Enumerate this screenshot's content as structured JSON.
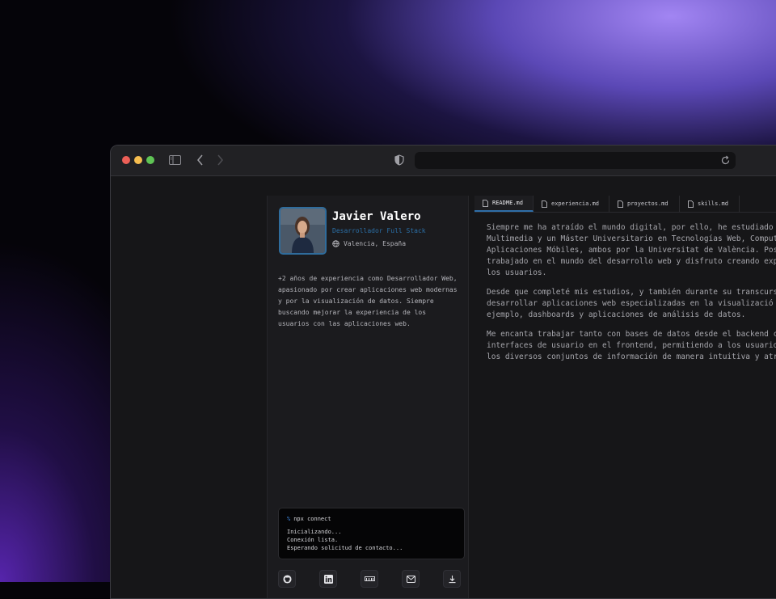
{
  "profile": {
    "name": "Javier Valero",
    "role": "Desarrollador Full Stack",
    "location": "Valencia, España",
    "bio": "+2 años de experiencia como Desarrollador Web, apasionado por crear aplicaciones web modernas y por la visualización de datos. Siempre buscando mejorar la experiencia de los usuarios con las aplicaciones web."
  },
  "tabs": [
    {
      "label": "README.md",
      "active": true
    },
    {
      "label": "experiencia.md",
      "active": false
    },
    {
      "label": "proyectos.md",
      "active": false
    },
    {
      "label": "skills.md",
      "active": false
    }
  ],
  "readme": {
    "p1": [
      "Siempre me ha atraído el mundo digital, por ello, he estudiado",
      "Multimedia y un Máster Universitario en Tecnologías Web, Comput",
      "Aplicaciones Móbiles, ambos por la Universitat de València. Pos",
      "trabajado en el mundo del desarrollo web y disfruto creando exp",
      "los usuarios."
    ],
    "p2": [
      "Desde que completé mis estudios, y también durante su transcurs",
      "desarrollar aplicaciones web especializadas en la visualizació",
      "ejemplo, dashboards y aplicaciones de análisis de datos."
    ],
    "p3": [
      "Me encanta trabajar tanto con bases de datos desde el backend c",
      "interfaces de usuario en el frontend, permitiendo a los usuario",
      "los diversos conjuntos de información de manera intuitiva y atr"
    ]
  },
  "terminal": {
    "prompt": "%",
    "command": "npx connect",
    "lines": [
      "Inicializando...",
      "Conexión lista.",
      "Esperando solicitud de contacto..."
    ]
  },
  "social": [
    "github-icon",
    "linkedin-icon",
    "npm-icon",
    "mail-icon",
    "download-icon"
  ],
  "colors": {
    "accent": "#2f6ea8",
    "role_text": "#2b6fa6",
    "window_bg": "#161618",
    "glow": "#8f75ff"
  }
}
